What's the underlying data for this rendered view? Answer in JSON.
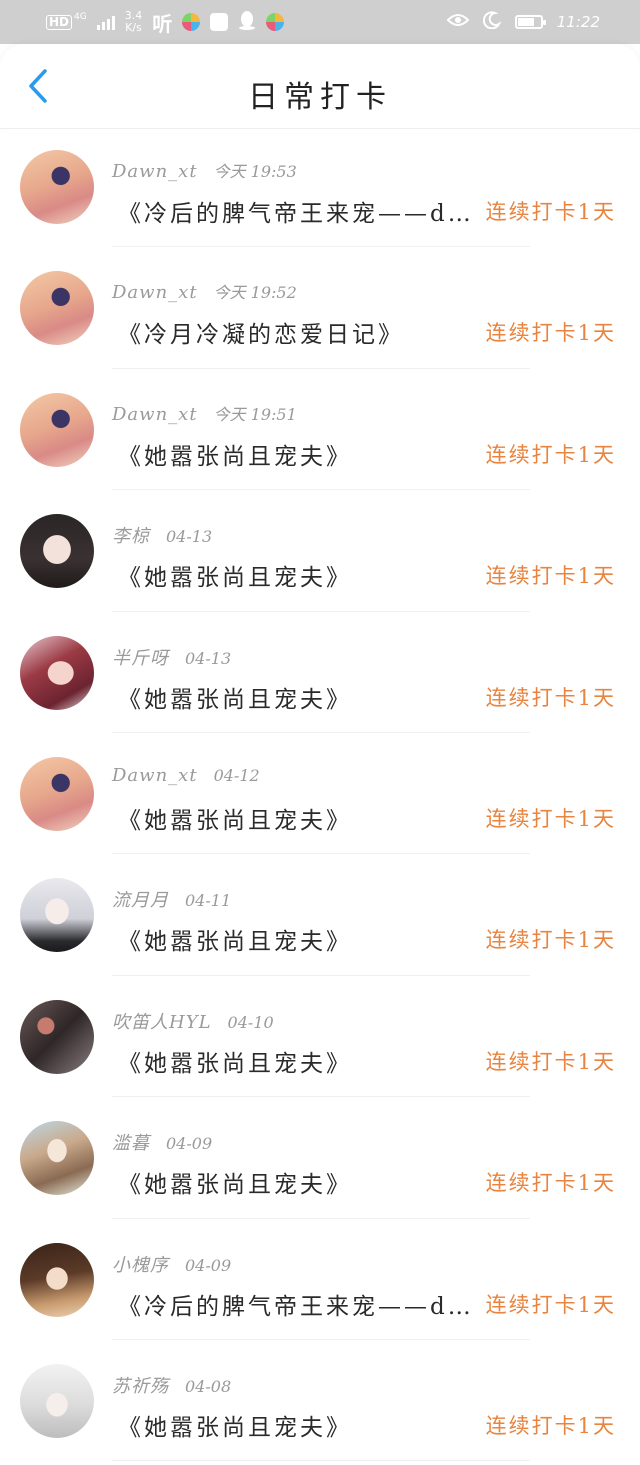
{
  "status_bar": {
    "network": "HD",
    "network_gen": "4G",
    "speed_value": "3.4",
    "speed_unit": "K/s",
    "ting_label": "听",
    "time": "11:22",
    "battery_level": 0.75
  },
  "header": {
    "title": "日常打卡"
  },
  "colors": {
    "accent": "#2a9bec",
    "checkin": "#e8843f",
    "meta": "#9a9a9a"
  },
  "feed": [
    {
      "user": "Dawn_xt",
      "time": "今天 19:53",
      "book": "《冷后的脾气帝王来宠——d…",
      "badge": "连续打卡1天",
      "avatar": "avatar-flower-girl"
    },
    {
      "user": "Dawn_xt",
      "time": "今天 19:52",
      "book": "《冷月冷凝的恋爱日记》",
      "badge": "连续打卡1天",
      "avatar": "avatar-flower-girl"
    },
    {
      "user": "Dawn_xt",
      "time": "今天 19:51",
      "book": "《她嚣张尚且宠夫》",
      "badge": "连续打卡1天",
      "avatar": "avatar-flower-girl"
    },
    {
      "user": "李椋",
      "time": "04-13",
      "book": "《她嚣张尚且宠夫》",
      "badge": "连续打卡1天",
      "avatar": "avatar-dark-hair-girl"
    },
    {
      "user": "半斤呀",
      "time": "04-13",
      "book": "《她嚣张尚且宠夫》",
      "badge": "连续打卡1天",
      "avatar": "avatar-red-hair-girl"
    },
    {
      "user": "Dawn_xt",
      "time": "04-12",
      "book": "《她嚣张尚且宠夫》",
      "badge": "连续打卡1天",
      "avatar": "avatar-flower-girl"
    },
    {
      "user": "流月月",
      "time": "04-11",
      "book": "《她嚣张尚且宠夫》",
      "badge": "连续打卡1天",
      "avatar": "avatar-silver-hair-girl"
    },
    {
      "user": "吹笛人HYL",
      "time": "04-10",
      "book": "《她嚣张尚且宠夫》",
      "badge": "连续打卡1天",
      "avatar": "avatar-dark-figure"
    },
    {
      "user": "滥暮",
      "time": "04-09",
      "book": "《她嚣张尚且宠夫》",
      "badge": "连续打卡1天",
      "avatar": "avatar-long-hair-girl"
    },
    {
      "user": "小槐序",
      "time": "04-09",
      "book": "《冷后的脾气帝王来宠——d…",
      "badge": "连续打卡1天",
      "avatar": "avatar-ancient-girl"
    },
    {
      "user": "苏祈殇",
      "time": "04-08",
      "book": "《她嚣张尚且宠夫》",
      "badge": "连续打卡1天",
      "avatar": "avatar-white-hair-boy"
    }
  ]
}
